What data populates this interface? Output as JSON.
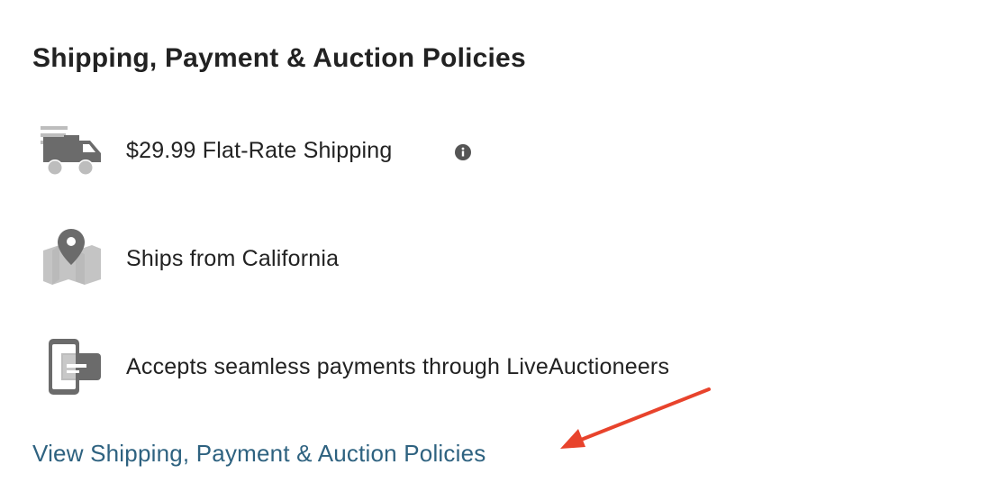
{
  "section": {
    "title": "Shipping, Payment & Auction Policies"
  },
  "policies": [
    {
      "icon": "truck-icon",
      "label": "$29.99 Flat-Rate Shipping",
      "has_info": true
    },
    {
      "icon": "map-pin-icon",
      "label": "Ships from California",
      "has_info": false
    },
    {
      "icon": "phone-card-icon",
      "label": "Accepts seamless payments through LiveAuctioneers",
      "has_info": false
    }
  ],
  "link": {
    "label": "View Shipping, Payment & Auction Policies"
  },
  "colors": {
    "text": "#222222",
    "link": "#2e6280",
    "icon_dark": "#6b6b6b",
    "icon_light": "#bdbdbd",
    "annotation": "#e8432c"
  }
}
